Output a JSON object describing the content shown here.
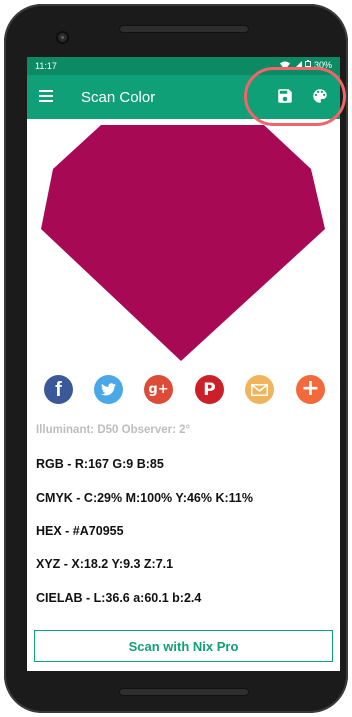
{
  "status": {
    "time": "11:17",
    "battery": "30%"
  },
  "app_bar": {
    "title": "Scan Color",
    "icons": [
      "menu-icon",
      "save-icon",
      "palette-icon"
    ]
  },
  "color": {
    "hex_value": "#A70955",
    "illuminant": "Illuminant: D50 Observer: 2°",
    "rgb": "RGB - R:167 G:9 B:85",
    "cmyk": "CMYK - C:29% M:100% Y:46% K:11%",
    "hex": "HEX - #A70955",
    "xyz": "XYZ - X:18.2 Y:9.3 Z:7.1",
    "cielab": "CIELAB - L:36.6 a:60.1 b:2.4"
  },
  "share": [
    {
      "name": "facebook",
      "glyph": "f",
      "color": "#3b5998"
    },
    {
      "name": "twitter",
      "glyph": "t",
      "color": "#4aa8e6"
    },
    {
      "name": "google-plus",
      "glyph": "g+",
      "color": "#dd4b39"
    },
    {
      "name": "pinterest",
      "glyph": "P",
      "color": "#cb2027"
    },
    {
      "name": "email",
      "glyph": "✉",
      "color": "#f0b45c"
    },
    {
      "name": "more",
      "glyph": "+",
      "color": "#f26a3c"
    }
  ],
  "scan_button": {
    "label": "Scan with Nix Pro"
  },
  "theme": {
    "app_bar": "#10a078",
    "status_bar": "#0c8a63",
    "highlight": "#f2646a"
  }
}
